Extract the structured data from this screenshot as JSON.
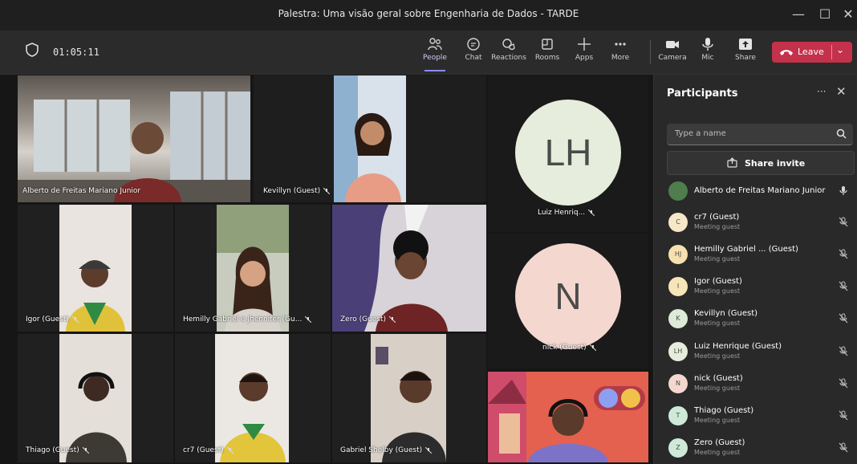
{
  "window": {
    "title": "Palestra: Uma visão geral sobre Engenharia de Dados - TARDE",
    "minimize": "—",
    "maximize": "☐",
    "close": "✕"
  },
  "toolbar": {
    "timer": "01:05:11",
    "items": [
      {
        "label": "People",
        "icon": "people-icon"
      },
      {
        "label": "Chat",
        "icon": "chat-icon"
      },
      {
        "label": "Reactions",
        "icon": "reactions-icon"
      },
      {
        "label": "Rooms",
        "icon": "rooms-icon"
      },
      {
        "label": "Apps",
        "icon": "apps-icon"
      },
      {
        "label": "More",
        "icon": "more-icon"
      },
      {
        "label": "Camera",
        "icon": "camera-icon"
      },
      {
        "label": "Mic",
        "icon": "mic-icon"
      },
      {
        "label": "Share",
        "icon": "share-icon"
      }
    ],
    "leave_label": "Leave",
    "leave_color": "#c4314b",
    "accent": "#8b8cf5"
  },
  "tiles": [
    {
      "name": "Alberto de Freitas Mariano Junior"
    },
    {
      "name": "Kevillyn (Guest)"
    },
    {
      "name": "Igor (Guest)"
    },
    {
      "name": "Hemilly Gabriel e Jhennifer (Gu..."
    },
    {
      "name": "Zero (Guest)"
    },
    {
      "name": "Thiago (Guest)"
    },
    {
      "name": "cr7 (Guest)"
    },
    {
      "name": "Gabriel Shelby (Guest)"
    },
    {
      "name": "Luiz Henriq...",
      "initials": "LH",
      "color": "#e6eddc"
    },
    {
      "name": "nick (Guest)",
      "initials": "N",
      "color": "#f4d7cf"
    }
  ],
  "panel": {
    "title": "Participants",
    "more": "···",
    "close": "✕",
    "search_placeholder": "Type a name",
    "share_invite": "Share invite",
    "participants": [
      {
        "name": "Alberto de Freitas Mariano Junior",
        "status": "",
        "initials": "",
        "color": "#4f7d4e"
      },
      {
        "name": "cr7 (Guest)",
        "status": "Meeting guest",
        "initials": "C",
        "color": "#f6e7c8"
      },
      {
        "name": "Hemilly Gabriel ... (Guest)",
        "status": "Meeting guest",
        "initials": "HJ",
        "color": "#f6e0b0"
      },
      {
        "name": "Igor (Guest)",
        "status": "Meeting guest",
        "initials": "I",
        "color": "#f6e5b8"
      },
      {
        "name": "Kevillyn (Guest)",
        "status": "Meeting guest",
        "initials": "K",
        "color": "#dcead8"
      },
      {
        "name": "Luiz Henrique (Guest)",
        "status": "Meeting guest",
        "initials": "LH",
        "color": "#e6eddc"
      },
      {
        "name": "nick (Guest)",
        "status": "Meeting guest",
        "initials": "N",
        "color": "#f4d7cf"
      },
      {
        "name": "Thiago (Guest)",
        "status": "Meeting guest",
        "initials": "T",
        "color": "#cfe9d8"
      },
      {
        "name": "Zero (Guest)",
        "status": "Meeting guest",
        "initials": "Z",
        "color": "#cfe9d8"
      }
    ]
  }
}
